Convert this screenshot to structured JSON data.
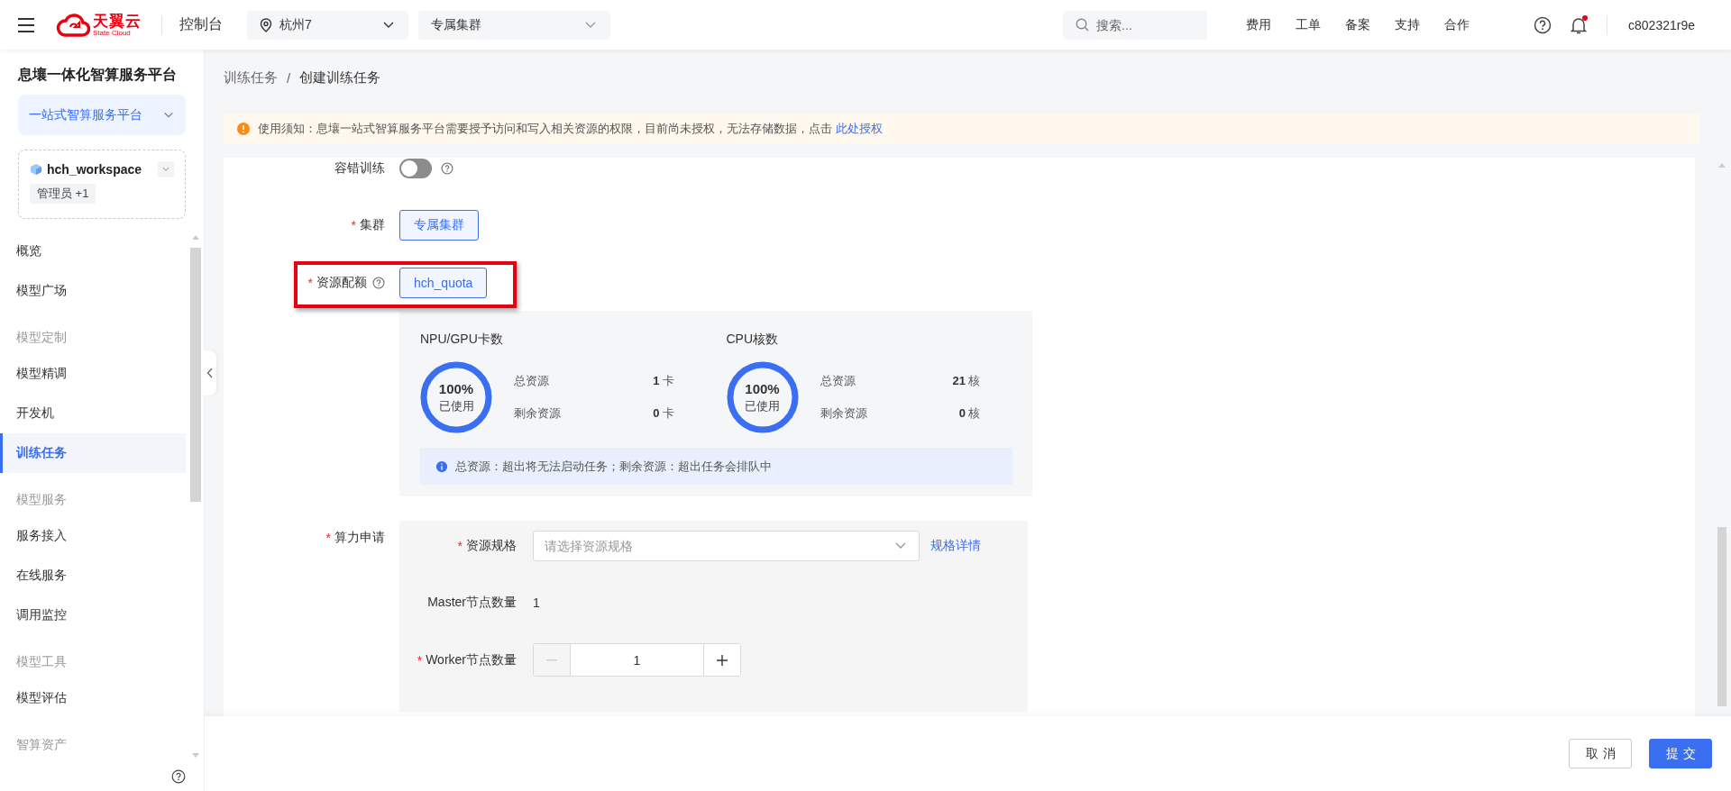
{
  "topbar": {
    "logo": {
      "name": "天翼云",
      "subtitle": "State Cloud"
    },
    "console_label": "控制台",
    "region_select": {
      "value": "杭州7"
    },
    "cluster_select": {
      "value": "专属集群"
    },
    "search": {
      "placeholder": "搜索..."
    },
    "links": [
      "费用",
      "工单",
      "备案",
      "支持",
      "合作"
    ],
    "notifications": {
      "unread": true
    },
    "user": "c802321r9e"
  },
  "sidebar": {
    "title": "息壤一体化智算服务平台",
    "platform_select": {
      "value": "一站式智算服务平台"
    },
    "workspace": {
      "name": "hch_workspace",
      "role_tag": "管理员 +1"
    },
    "nav": [
      {
        "kind": "item",
        "label": "概览",
        "selected": false
      },
      {
        "kind": "item",
        "label": "模型广场",
        "selected": false
      },
      {
        "kind": "group",
        "label": "模型定制"
      },
      {
        "kind": "item",
        "label": "模型精调",
        "selected": false
      },
      {
        "kind": "item",
        "label": "开发机",
        "selected": false
      },
      {
        "kind": "item",
        "label": "训练任务",
        "selected": true
      },
      {
        "kind": "group",
        "label": "模型服务"
      },
      {
        "kind": "item",
        "label": "服务接入",
        "selected": false
      },
      {
        "kind": "item",
        "label": "在线服务",
        "selected": false
      },
      {
        "kind": "item",
        "label": "调用监控",
        "selected": false
      },
      {
        "kind": "group",
        "label": "模型工具"
      },
      {
        "kind": "item",
        "label": "模型评估",
        "selected": false
      },
      {
        "kind": "group",
        "label": "智算资产"
      }
    ]
  },
  "breadcrumb": {
    "items": [
      "训练任务",
      "创建训练任务"
    ],
    "separator": "/"
  },
  "notice": {
    "text": "使用须知：息壤一站式智算服务平台需要授予访问和写入相关资源的权限，目前尚未授权，无法存储数据，点击 ",
    "link": "此处授权"
  },
  "form": {
    "required_mark": "*",
    "fault_tolerance": {
      "label": "容错训练",
      "on": false
    },
    "cluster": {
      "label": "集群",
      "required": true,
      "options": [
        {
          "label": "专属集群",
          "selected": true
        }
      ]
    },
    "quota": {
      "label": "资源配额",
      "required": true,
      "highlighted": true,
      "options": [
        {
          "label": "hch_quota",
          "selected": true
        }
      ]
    },
    "quota_panel": {
      "resources": [
        {
          "title": "NPU/GPU卡数",
          "percent": "100%",
          "used_label": "已使用",
          "level": 1,
          "rows": [
            {
              "label": "总资源",
              "value": "**1** 卡"
            },
            {
              "label": "剩余资源",
              "value": "**0** 卡"
            }
          ]
        },
        {
          "title": "CPU核数",
          "percent": "100%",
          "used_label": "已使用",
          "level": 1,
          "rows": [
            {
              "label": "总资源",
              "value": "**21** 核"
            },
            {
              "label": "剩余资源",
              "value": "**0** 核"
            }
          ]
        }
      ],
      "tip": "总资源：超出将无法启动任务；剩余资源：超出任务会排队中"
    },
    "compute": {
      "label": "算力申请",
      "required": true,
      "spec": {
        "label": "资源规格",
        "required": true,
        "placeholder": "请选择资源规格",
        "link": "规格详情"
      },
      "master": {
        "label": "Master节点数量",
        "value": "1"
      },
      "worker": {
        "label": "Worker节点数量",
        "required": true,
        "value": "1",
        "decrement_disabled": true
      }
    }
  },
  "footer": {
    "buttons": [
      {
        "label": "取消",
        "kind": "default"
      },
      {
        "label": "提交",
        "kind": "primary"
      }
    ]
  }
}
